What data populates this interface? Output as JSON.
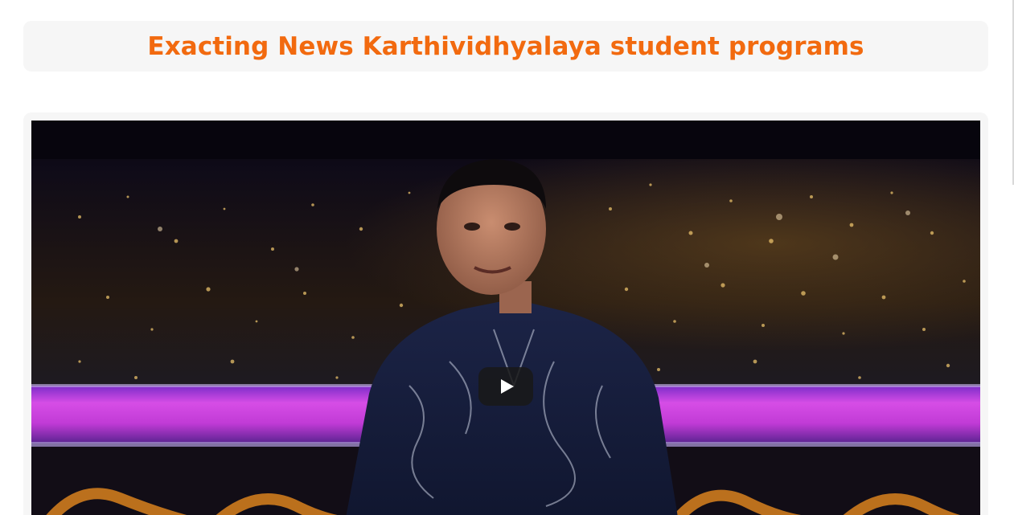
{
  "header": {
    "title": "Exacting News Karthividhyalaya student programs",
    "title_color": "#f26a0f",
    "background": "#f6f6f6"
  },
  "video": {
    "play_icon": "play-icon",
    "button_color": "#191919"
  }
}
